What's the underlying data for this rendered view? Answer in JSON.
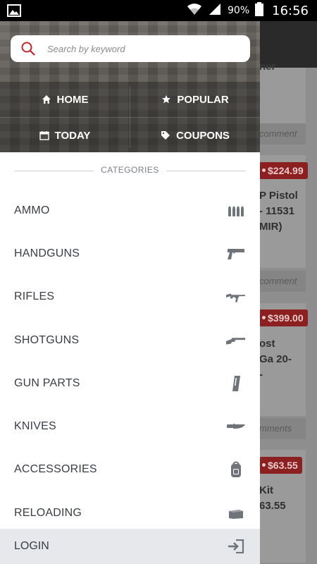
{
  "status_bar": {
    "battery_percent": "90%",
    "time": "16:56",
    "icons": [
      "gallery-icon",
      "wifi-icon",
      "signal-icon",
      "battery-icon"
    ]
  },
  "search": {
    "placeholder": "Search by keyword"
  },
  "quick_nav": [
    {
      "label": "HOME",
      "icon": "home-icon"
    },
    {
      "label": "POPULAR",
      "icon": "star-icon"
    },
    {
      "label": "TODAY",
      "icon": "calendar-icon"
    },
    {
      "label": "COUPONS",
      "icon": "tag-icon"
    }
  ],
  "categories": {
    "title": "CATEGORIES",
    "items": [
      {
        "label": "AMMO",
        "icon": "ammo-icon"
      },
      {
        "label": "HANDGUNS",
        "icon": "handgun-icon"
      },
      {
        "label": "RIFLES",
        "icon": "rifle-icon"
      },
      {
        "label": "SHOTGUNS",
        "icon": "shotgun-icon"
      },
      {
        "label": "GUN PARTS",
        "icon": "magazine-icon"
      },
      {
        "label": "KNIVES",
        "icon": "knife-icon"
      },
      {
        "label": "ACCESSORIES",
        "icon": "backpack-icon"
      },
      {
        "label": "RELOADING",
        "icon": "ammo-box-icon"
      }
    ]
  },
  "login": {
    "label": "LOGIN",
    "icon": "login-icon"
  },
  "background": {
    "top_fragment": "ner",
    "comment_1": "comment",
    "price_1": "$224.99",
    "title_1": [
      "P Pistol",
      "- 11531",
      "MIR)"
    ],
    "comment_2": "comment",
    "price_2": "$399.00",
    "title_2": [
      "ost",
      "Ga 20-",
      "-"
    ],
    "comment_3": "mments",
    "price_3": "$63.55",
    "title_3": [
      "Kit",
      "63.55"
    ]
  },
  "colors": {
    "accent_red": "#c4262e",
    "drawer_text": "#3a3d45",
    "login_bg": "#e6e8ec"
  }
}
